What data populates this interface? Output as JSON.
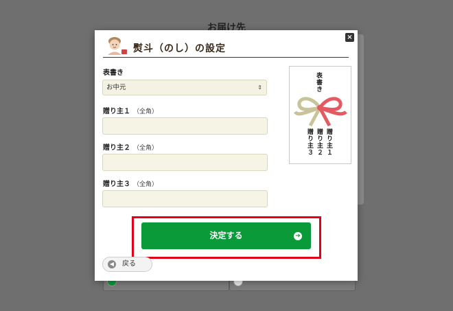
{
  "background": {
    "page_title": "お届け先"
  },
  "modal": {
    "title": "熨斗（のし）の設定",
    "close_label": "×",
    "omotegaki": {
      "label": "表書き",
      "selected": "お中元",
      "arrow": "⇕"
    },
    "giver1": {
      "label": "贈り主１",
      "note": "（全角）",
      "value": ""
    },
    "giver2": {
      "label": "贈り主２",
      "note": "（全角）",
      "value": ""
    },
    "giver3": {
      "label": "贈り主３",
      "note": "（全角）",
      "value": ""
    },
    "preview": {
      "omotegaki": "表書き",
      "giver1": "贈り主１",
      "giver2": "贈り主２",
      "giver3": "贈り主３"
    },
    "submit_label": "決定する",
    "submit_icon": "➔",
    "back_label": "戻る",
    "back_icon": "◀"
  },
  "colors": {
    "accent_green": "#0a9a3a",
    "highlight_red": "#e2001a",
    "ribbon_red": "#e55a62",
    "ribbon_gold": "#c9c39a"
  }
}
